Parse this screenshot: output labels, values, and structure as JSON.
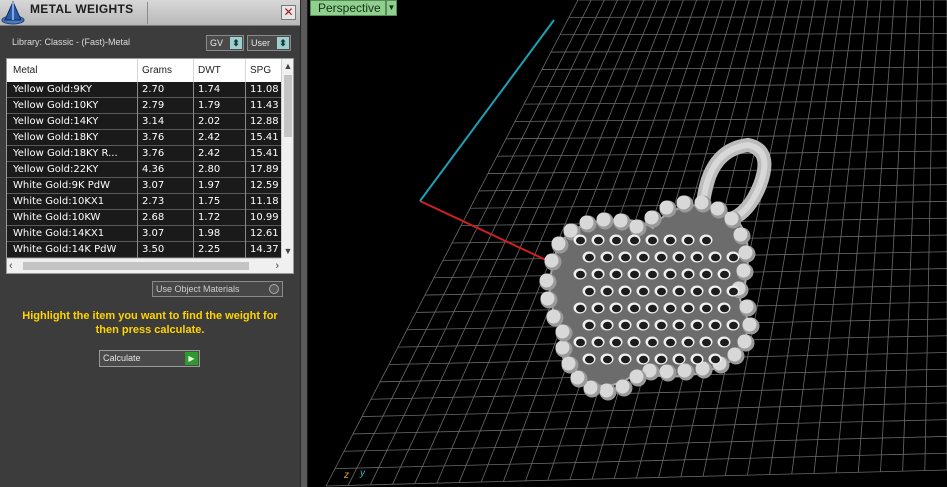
{
  "panel": {
    "title": "METAL WEIGHTS",
    "close_symbol": "✕",
    "library_text": "Library: Classic - (Fast)-Metal",
    "gv_label": "GV",
    "user_label": "User",
    "icon_logo": "application-logo-icon",
    "table": {
      "headers": [
        "Metal",
        "Grams",
        "DWT",
        "SPG"
      ],
      "rows": [
        [
          "Yellow Gold:9KY",
          "2.70",
          "1.74",
          "11.08"
        ],
        [
          "Yellow Gold:10KY",
          "2.79",
          "1.79",
          "11.43"
        ],
        [
          "Yellow Gold:14KY",
          "3.14",
          "2.02",
          "12.88"
        ],
        [
          "Yellow Gold:18KY",
          "3.76",
          "2.42",
          "15.41"
        ],
        [
          "Yellow Gold:18KY R...",
          "3.76",
          "2.42",
          "15.41"
        ],
        [
          "Yellow Gold:22KY",
          "4.36",
          "2.80",
          "17.89"
        ],
        [
          "White Gold:9K PdW",
          "3.07",
          "1.97",
          "12.59"
        ],
        [
          "White Gold:10KX1",
          "2.73",
          "1.75",
          "11.18"
        ],
        [
          "White Gold:10KW",
          "2.68",
          "1.72",
          "10.99"
        ],
        [
          "White Gold:14KX1",
          "3.07",
          "1.98",
          "12.61"
        ],
        [
          "White Gold:14K PdW",
          "3.50",
          "2.25",
          "14.37"
        ]
      ]
    },
    "use_object_materials": "Use Object Materials",
    "instructions": "Highlight the item you want to find the weight for then press calculate.",
    "calculate_label": "Calculate"
  },
  "viewport": {
    "label": "Perspective",
    "axis_z": "z",
    "axis_y": "y",
    "colors": {
      "grid": "#6a6a6a",
      "axis_red": "#d02020",
      "axis_cyan": "#1ea0b4",
      "model": "#d8d8d8",
      "label_bg": "#8fd08f"
    }
  },
  "colors": {
    "panel_bg": "#3c3c3c",
    "instructions": "#ffd400"
  }
}
